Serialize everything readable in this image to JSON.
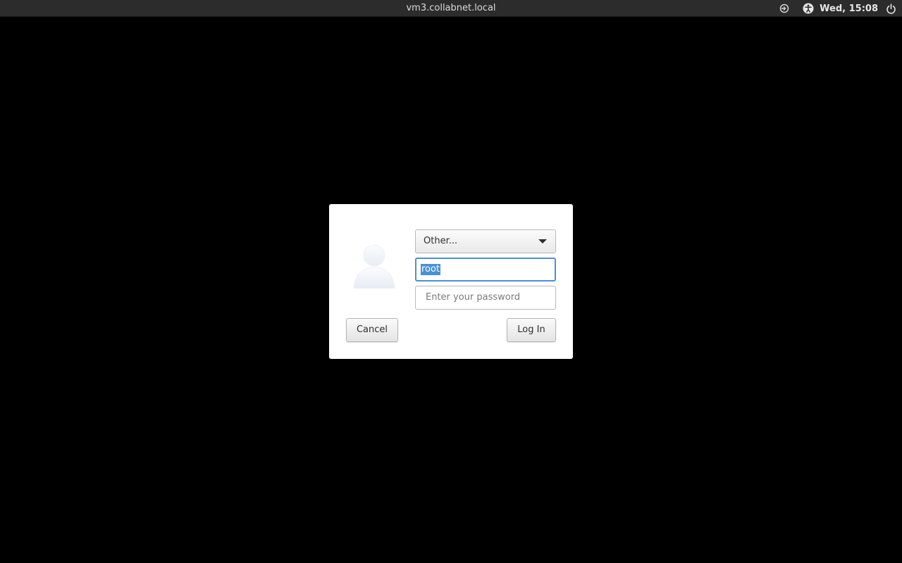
{
  "topbar": {
    "hostname": "vm3.collabnet.local",
    "clock": "Wed, 15:08",
    "icons": [
      "display-icon",
      "accessibility-icon",
      "power-icon"
    ]
  },
  "login": {
    "user_selector": "Other...",
    "username_value": "root",
    "password_placeholder": "Enter your password",
    "cancel_label": "Cancel",
    "login_label": "Log In"
  },
  "colors": {
    "background": "#000000",
    "topbar": "#2c2c2c",
    "focus_accent": "#4a90d9",
    "dialog": "#ffffff"
  }
}
